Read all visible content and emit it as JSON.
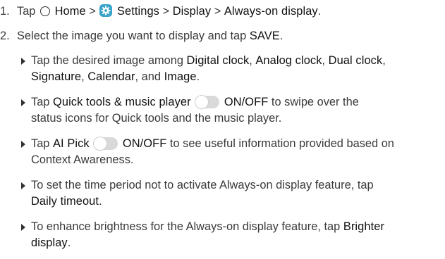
{
  "steps": [
    {
      "number": "1.",
      "t_tap": "Tap",
      "t_home": "Home",
      "t_sep1": ">",
      "t_settings": "Settings",
      "t_sep2": ">",
      "t_display": "Display",
      "t_sep3": ">",
      "t_aod": "Always-on display",
      "t_end": "."
    },
    {
      "number": "2.",
      "t_pre": "Select the image you want to display and tap",
      "t_save": "SAVE",
      "t_end": "."
    }
  ],
  "bullets": [
    {
      "line1_pre": "Tap the desired image among",
      "digital_clock": "Digital clock",
      "c1": ",",
      "analog_clock": "Analog clock",
      "c2": ",",
      "dual_clock": "Dual clock",
      "c3": ",",
      "signature": "Signature",
      "c4": ",",
      "calendar": "Calendar",
      "and": ", and",
      "image": "Image",
      "end": "."
    },
    {
      "tap": "Tap",
      "quick_tools": "Quick tools & music player",
      "onoff": "ON/OFF",
      "line1_post": "to swipe over the",
      "line2": "status icons for Quick tools and the music player."
    },
    {
      "tap": "Tap",
      "ai_pick": "AI Pick",
      "onoff": "ON/OFF",
      "line1_post": "to see useful information provided based on",
      "line2": "Context Awareness."
    },
    {
      "line1": "To set the time period not to activate Always-on display feature, tap",
      "daily_timeout": "Daily timeout",
      "end": "."
    },
    {
      "line1": "To enhance brightness for the Always-on display feature, tap",
      "brighter": "Brighter",
      "display": "display",
      "end": "."
    }
  ],
  "icons": {
    "home": "home-circle-icon",
    "settings": "settings-gear-icon",
    "toggle": "toggle-off-icon"
  },
  "colors": {
    "settings_icon_bg": "#3aa3c9",
    "toggle_track": "#d9d9d9"
  }
}
